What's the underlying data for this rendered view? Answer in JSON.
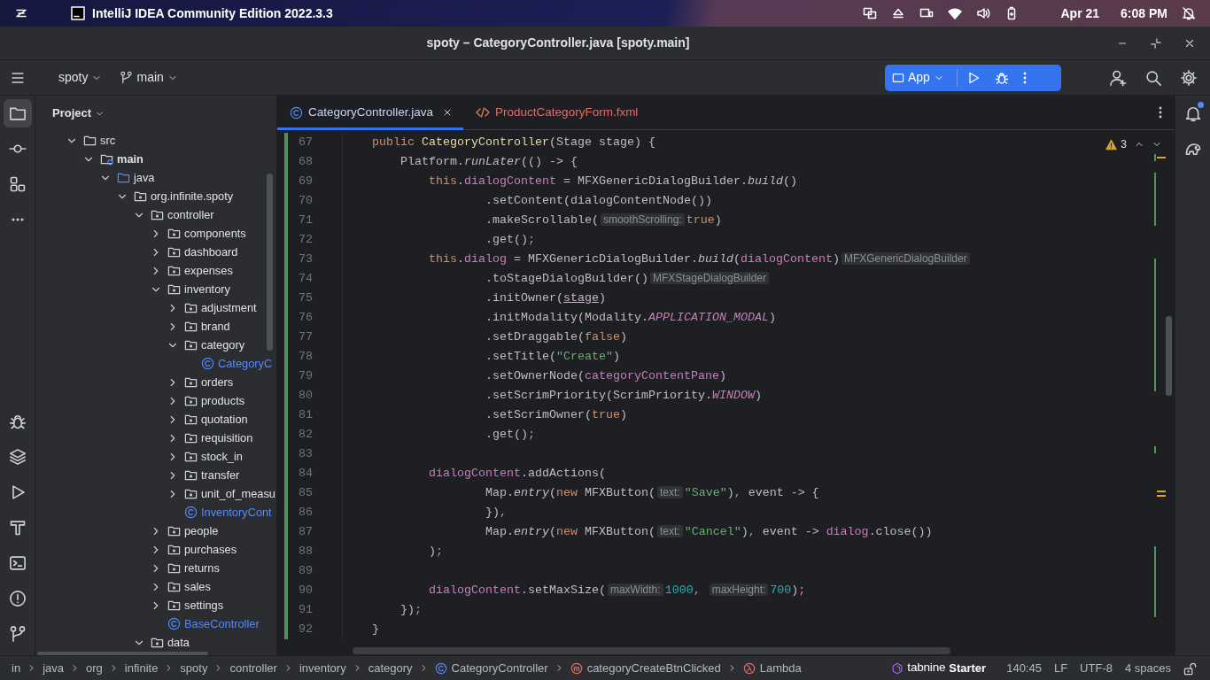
{
  "os_bar": {
    "app_name": "IntelliJ IDEA Community Edition 2022.3.3",
    "date": "Apr 21",
    "time": "6:08 PM"
  },
  "window": {
    "title": "spoty – CategoryController.java [spoty.main]"
  },
  "toolbar": {
    "project": "spoty",
    "branch": "main",
    "run_config": "App"
  },
  "tools_top": [
    {
      "kind": "project",
      "selected": true
    },
    {
      "kind": "commit",
      "selected": false
    },
    {
      "kind": "structure",
      "selected": false
    },
    {
      "kind": "more",
      "selected": false
    }
  ],
  "tools_bottom": [
    {
      "kind": "debug",
      "selected": false
    },
    {
      "kind": "services",
      "selected": false
    },
    {
      "kind": "run",
      "selected": false
    },
    {
      "kind": "build",
      "selected": false
    },
    {
      "kind": "terminal",
      "selected": false
    },
    {
      "kind": "problems",
      "selected": false
    },
    {
      "kind": "git",
      "selected": false
    }
  ],
  "tools_right": [
    {
      "kind": "notifications",
      "unread": true
    },
    {
      "kind": "gradle",
      "unread": false
    }
  ],
  "project_panel": {
    "title": "Project",
    "tree": [
      {
        "label": "src",
        "kind": "folder",
        "expanded": true,
        "children": [
          {
            "label": "main",
            "kind": "source_set",
            "expanded": true,
            "children": [
              {
                "label": "java",
                "kind": "source_root",
                "expanded": true,
                "children": [
                  {
                    "label": "org.infinite.spoty",
                    "kind": "package",
                    "expanded": true,
                    "children": [
                      {
                        "label": "controller",
                        "kind": "package",
                        "expanded": true,
                        "children": [
                          {
                            "label": "components",
                            "kind": "package",
                            "expanded": false
                          },
                          {
                            "label": "dashboard",
                            "kind": "package",
                            "expanded": false
                          },
                          {
                            "label": "expenses",
                            "kind": "package",
                            "expanded": false
                          },
                          {
                            "label": "inventory",
                            "kind": "package",
                            "expanded": true,
                            "children": [
                              {
                                "label": "adjustment",
                                "kind": "package",
                                "expanded": false
                              },
                              {
                                "label": "brand",
                                "kind": "package",
                                "expanded": false
                              },
                              {
                                "label": "category",
                                "kind": "package",
                                "expanded": true,
                                "children": [
                                  {
                                    "label": "CategoryC",
                                    "kind": "class"
                                  }
                                ]
                              },
                              {
                                "label": "orders",
                                "kind": "package",
                                "expanded": false
                              },
                              {
                                "label": "products",
                                "kind": "package",
                                "expanded": false
                              },
                              {
                                "label": "quotation",
                                "kind": "package",
                                "expanded": false
                              },
                              {
                                "label": "requisition",
                                "kind": "package",
                                "expanded": false
                              },
                              {
                                "label": "stock_in",
                                "kind": "package",
                                "expanded": false
                              },
                              {
                                "label": "transfer",
                                "kind": "package",
                                "expanded": false
                              },
                              {
                                "label": "unit_of_measu",
                                "kind": "package",
                                "expanded": false
                              },
                              {
                                "label": "InventoryCont",
                                "kind": "class"
                              }
                            ]
                          },
                          {
                            "label": "people",
                            "kind": "package",
                            "expanded": false
                          },
                          {
                            "label": "purchases",
                            "kind": "package",
                            "expanded": false
                          },
                          {
                            "label": "returns",
                            "kind": "package",
                            "expanded": false
                          },
                          {
                            "label": "sales",
                            "kind": "package",
                            "expanded": false
                          },
                          {
                            "label": "settings",
                            "kind": "package",
                            "expanded": false
                          },
                          {
                            "label": "BaseController",
                            "kind": "class"
                          }
                        ]
                      },
                      {
                        "label": "data",
                        "kind": "package",
                        "expanded": true
                      }
                    ]
                  }
                ]
              }
            ]
          }
        ]
      }
    ]
  },
  "editor": {
    "tabs": [
      {
        "label": "CategoryController.java",
        "kind": "java",
        "selected": true,
        "error": false
      },
      {
        "label": "ProductCategoryForm.fxml",
        "kind": "xml",
        "selected": false,
        "error": true
      }
    ],
    "warnings": "3",
    "lines": [
      {
        "number": "67",
        "kind": "member",
        "tokens": [
          {
            "kind": "kw",
            "text": "public"
          },
          {
            "kind": "decl",
            "text": "CategoryController"
          },
          {
            "kind": "plain",
            "text": "(Stage stage) {"
          }
        ]
      },
      {
        "number": "68",
        "kind": "block",
        "tokens": [
          {
            "kind": "plain",
            "text": "Platform."
          },
          {
            "kind": "italic",
            "text": "runLater"
          },
          {
            "kind": "plain",
            "text": "(() -> {"
          }
        ]
      },
      {
        "number": "69",
        "kind": "statement",
        "tokens": [
          {
            "kind": "kw",
            "text": "this"
          },
          {
            "kind": "plain",
            "text": "."
          },
          {
            "kind": "field",
            "text": "dialogContent"
          },
          {
            "kind": "plain",
            "text": " = MFXGenericDialogBuilder."
          },
          {
            "kind": "italic",
            "text": "build"
          },
          {
            "kind": "plain",
            "text": "()"
          }
        ]
      },
      {
        "number": "70",
        "kind": "chain",
        "tokens": [
          {
            "kind": "plain",
            "text": ".setContent(dialogContentNode())"
          }
        ]
      },
      {
        "number": "71",
        "kind": "chain",
        "tokens": [
          {
            "kind": "plain",
            "text": ".makeScrollable("
          },
          {
            "kind": "hint",
            "text": "smoothScrolling:"
          },
          {
            "kind": "kw",
            "text": "true"
          },
          {
            "kind": "plain",
            "text": ")"
          }
        ]
      },
      {
        "number": "72",
        "kind": "chain",
        "tokens": [
          {
            "kind": "plain",
            "text": ".get()"
          },
          {
            "kind": "kw",
            "text": ";"
          }
        ]
      },
      {
        "number": "73",
        "kind": "statement",
        "tokens": [
          {
            "kind": "kw",
            "text": "this"
          },
          {
            "kind": "plain",
            "text": "."
          },
          {
            "kind": "field",
            "text": "dialog"
          },
          {
            "kind": "plain",
            "text": " = MFXGenericDialogBuilder."
          },
          {
            "kind": "italic",
            "text": "build"
          },
          {
            "kind": "plain",
            "text": "("
          },
          {
            "kind": "field",
            "text": "dialogContent"
          },
          {
            "kind": "plain",
            "text": ")"
          },
          {
            "kind": "hint",
            "text": "MFXGenericDialogBuilder"
          }
        ]
      },
      {
        "number": "74",
        "kind": "chain",
        "tokens": [
          {
            "kind": "plain",
            "text": ".toStageDialogBuilder()"
          },
          {
            "kind": "hint",
            "text": "MFXStageDialogBuilder"
          }
        ]
      },
      {
        "number": "75",
        "kind": "chain",
        "tokens": [
          {
            "kind": "plain",
            "text": ".initOwner("
          },
          {
            "kind": "param",
            "text": "stage"
          },
          {
            "kind": "plain",
            "text": ")"
          }
        ]
      },
      {
        "number": "76",
        "kind": "chain",
        "tokens": [
          {
            "kind": "plain",
            "text": ".initModality(Modality."
          },
          {
            "kind": "const",
            "text": "APPLICATION_MODAL"
          },
          {
            "kind": "plain",
            "text": ")"
          }
        ]
      },
      {
        "number": "77",
        "kind": "chain",
        "tokens": [
          {
            "kind": "plain",
            "text": ".setDraggable("
          },
          {
            "kind": "kw",
            "text": "false"
          },
          {
            "kind": "plain",
            "text": ")"
          }
        ]
      },
      {
        "number": "78",
        "kind": "chain",
        "tokens": [
          {
            "kind": "plain",
            "text": ".setTitle("
          },
          {
            "kind": "str",
            "text": "\"Create\""
          },
          {
            "kind": "plain",
            "text": ")"
          }
        ]
      },
      {
        "number": "79",
        "kind": "chain",
        "tokens": [
          {
            "kind": "plain",
            "text": ".setOwnerNode("
          },
          {
            "kind": "field",
            "text": "categoryContentPane"
          },
          {
            "kind": "plain",
            "text": ")"
          }
        ]
      },
      {
        "number": "80",
        "kind": "chain",
        "tokens": [
          {
            "kind": "plain",
            "text": ".setScrimPriority(ScrimPriority."
          },
          {
            "kind": "const",
            "text": "WINDOW"
          },
          {
            "kind": "plain",
            "text": ")"
          }
        ]
      },
      {
        "number": "81",
        "kind": "chain",
        "tokens": [
          {
            "kind": "plain",
            "text": ".setScrimOwner("
          },
          {
            "kind": "kw",
            "text": "true"
          },
          {
            "kind": "plain",
            "text": ")"
          }
        ]
      },
      {
        "number": "82",
        "kind": "chain",
        "tokens": [
          {
            "kind": "plain",
            "text": ".get()"
          },
          {
            "kind": "kw",
            "text": ";"
          }
        ]
      },
      {
        "number": "83",
        "kind": "blank"
      },
      {
        "number": "84",
        "kind": "statement",
        "tokens": [
          {
            "kind": "field",
            "text": "dialogContent"
          },
          {
            "kind": "plain",
            "text": ".addActions("
          }
        ]
      },
      {
        "number": "85",
        "kind": "chain",
        "tokens": [
          {
            "kind": "plain",
            "text": "Map."
          },
          {
            "kind": "italic",
            "text": "entry"
          },
          {
            "kind": "plain",
            "text": "("
          },
          {
            "kind": "kw",
            "text": "new"
          },
          {
            "kind": "plain",
            "text": " MFXButton("
          },
          {
            "kind": "hint",
            "text": "text:"
          },
          {
            "kind": "str",
            "text": "\"Save\""
          },
          {
            "kind": "plain",
            "text": ")"
          },
          {
            "kind": "kw",
            "text": ","
          },
          {
            "kind": "plain",
            "text": " event -> {"
          }
        ]
      },
      {
        "number": "86",
        "kind": "chain",
        "tokens": [
          {
            "kind": "plain",
            "text": "})"
          },
          {
            "kind": "kw",
            "text": ","
          }
        ]
      },
      {
        "number": "87",
        "kind": "chain",
        "tokens": [
          {
            "kind": "plain",
            "text": "Map."
          },
          {
            "kind": "italic",
            "text": "entry"
          },
          {
            "kind": "plain",
            "text": "("
          },
          {
            "kind": "kw",
            "text": "new"
          },
          {
            "kind": "plain",
            "text": " MFXButton("
          },
          {
            "kind": "hint",
            "text": "text:"
          },
          {
            "kind": "str",
            "text": "\"Cancel\""
          },
          {
            "kind": "plain",
            "text": ")"
          },
          {
            "kind": "kw",
            "text": ","
          },
          {
            "kind": "plain",
            "text": " event -> "
          },
          {
            "kind": "field",
            "text": "dialog"
          },
          {
            "kind": "plain",
            "text": ".close())"
          }
        ]
      },
      {
        "number": "88",
        "kind": "statement",
        "tokens": [
          {
            "kind": "plain",
            "text": ")"
          },
          {
            "kind": "kw",
            "text": ";"
          }
        ]
      },
      {
        "number": "89",
        "kind": "blank"
      },
      {
        "number": "90",
        "kind": "statement",
        "tokens": [
          {
            "kind": "field",
            "text": "dialogContent"
          },
          {
            "kind": "plain",
            "text": ".setMaxSize("
          },
          {
            "kind": "hint",
            "text": "maxWidth:"
          },
          {
            "kind": "num",
            "text": "1000"
          },
          {
            "kind": "kw",
            "text": ","
          },
          {
            "kind": "hint",
            "text": "maxHeight:"
          },
          {
            "kind": "num",
            "text": "700"
          },
          {
            "kind": "plain",
            "text": ")"
          },
          {
            "kind": "kw",
            "text": ";"
          }
        ]
      },
      {
        "number": "91",
        "kind": "block",
        "tokens": [
          {
            "kind": "plain",
            "text": "})"
          },
          {
            "kind": "kw",
            "text": ";"
          }
        ]
      },
      {
        "number": "92",
        "kind": "member",
        "tokens": [
          {
            "kind": "plain",
            "text": "}"
          }
        ]
      }
    ]
  },
  "breadcrumbs": [
    {
      "label": "in",
      "kind": "folder"
    },
    {
      "label": "java",
      "kind": "folder"
    },
    {
      "label": "org",
      "kind": "folder"
    },
    {
      "label": "infinite",
      "kind": "folder"
    },
    {
      "label": "spoty",
      "kind": "folder"
    },
    {
      "label": "controller",
      "kind": "folder"
    },
    {
      "label": "inventory",
      "kind": "folder"
    },
    {
      "label": "category",
      "kind": "folder"
    },
    {
      "label": "CategoryController",
      "kind": "class"
    },
    {
      "label": "categoryCreateBtnClicked",
      "kind": "method"
    },
    {
      "label": "Lambda",
      "kind": "lambda"
    }
  ],
  "status_bar": {
    "plugin_name": "tabnine",
    "plugin_plan": "Starter",
    "position": "140:45",
    "line_separator": "LF",
    "encoding": "UTF-8",
    "indent": "4 spaces"
  }
}
